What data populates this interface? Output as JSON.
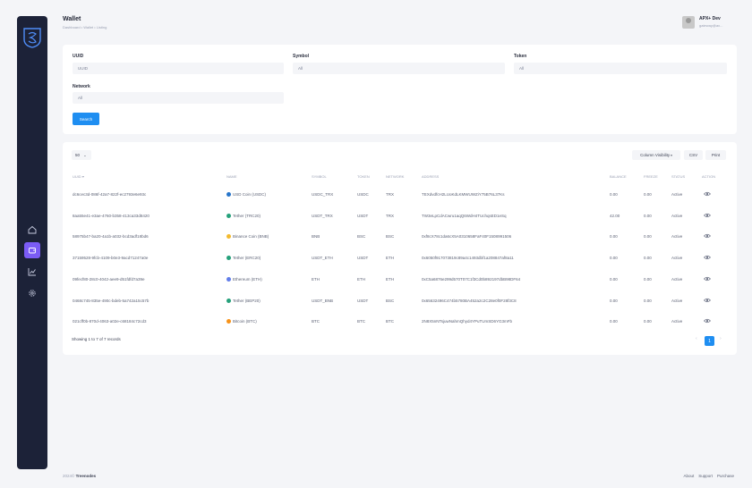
{
  "header": {
    "title": "Wallet",
    "breadcrumb": "Dashboard • Wallet • Listing"
  },
  "user": {
    "name": "APX+ Dev",
    "email": "gateway@ax..."
  },
  "sidebar": {
    "items": [
      "home-icon",
      "wallet-icon",
      "chart-icon",
      "settings-icon"
    ],
    "active_index": 1
  },
  "filters": {
    "uuid_label": "UUID",
    "uuid_placeholder": "UUID",
    "symbol_label": "Symbol",
    "symbol_value": "All",
    "token_label": "Token",
    "token_value": "All",
    "network_label": "Network",
    "network_value": "All",
    "search_label": "Search"
  },
  "table_tools": {
    "page_size": "50",
    "column_visibility": "Column Visibility",
    "csv": "CSV",
    "print": "Print"
  },
  "columns": [
    "UUID",
    "NAME",
    "SYMBOL",
    "TOKEN",
    "NETWORK",
    "ADDRESS",
    "BALANCE",
    "FREEZE",
    "STATUS",
    "ACTION"
  ],
  "rows": [
    {
      "uuid": "dc6cec3d-086f-42a7-822f-ec2793e6e93c",
      "name": "USD Coin (USDC)",
      "coin_color": "#2775ca",
      "symbol": "USDC_TRX",
      "token": "USDC",
      "network": "TRX",
      "address": "TEXdvdfcH2LUoKdLKMWUWZiY75B76L37Ks",
      "balance": "0.00",
      "freeze": "0.00",
      "status": "Active"
    },
    {
      "uuid": "8aa55e41-e3ae-4760-b358-413ca33d8420",
      "name": "Tether (TRC20)",
      "coin_color": "#26a17b",
      "symbol": "USDT_TRX",
      "token": "USDT",
      "network": "TRX",
      "address": "TW3eLpCdACwru1aqQ6WdH4TUchqsED1eSq",
      "balance": "42.00",
      "freeze": "0.00",
      "status": "Active"
    },
    {
      "uuid": "58975b47-ba20-4a1b-a032-bcd3adf18bd6",
      "name": "Binance Coin (BNB)",
      "coin_color": "#f3ba2f",
      "symbol": "BNB",
      "token": "BSC",
      "network": "BSC",
      "address": "0xf8cX78c1da6cX5A0310658FaF40F1508991506",
      "balance": "0.00",
      "freeze": "0.00",
      "status": "Active"
    },
    {
      "uuid": "37159528-9fcb-4109-b0e3-9acd71247a0e",
      "name": "Tether (ERC20)",
      "coin_color": "#26a17b",
      "symbol": "USDT_ETH",
      "token": "USDT",
      "network": "ETH",
      "address": "0x6050f917073819c89a4c1493dbf1a208847af8a11",
      "balance": "0.00",
      "freeze": "0.00",
      "status": "Active"
    },
    {
      "uuid": "09fecf80-28c0-4042-aee9-d51fdfd7a39e",
      "name": "Ethereum (ETH)",
      "coin_color": "#627eea",
      "symbol": "ETH",
      "token": "ETH",
      "network": "ETH",
      "address": "0xC5a6876e299d570T07C1f3Cd0b892197dbB98DF64",
      "balance": "0.00",
      "freeze": "0.00",
      "status": "Active"
    },
    {
      "uuid": "0468c745-835e-490c-bdeb-5a742a15c57b",
      "name": "Tether (BEP20)",
      "coin_color": "#26a17b",
      "symbol": "USDT_BNB",
      "token": "USDT",
      "network": "BSC",
      "address": "0x65632496C474b5780BA452a2c2C28e0f0F28f3C8",
      "balance": "0.00",
      "freeze": "0.00",
      "status": "Active"
    },
    {
      "uuid": "021cff0b-870d-4063-a02e-c68184c72cd3",
      "name": "Bitcoin (BTC)",
      "coin_color": "#f7931a",
      "symbol": "BTC",
      "token": "BTC",
      "network": "BTC",
      "address": "2N8X5nNTsjuwNahmQhyd4YPuTUmSD6YG3mFb",
      "balance": "0.00",
      "freeze": "0.00",
      "status": "Active"
    }
  ],
  "showing_text": "Showing 1 to 7 of 7 records",
  "pagination": {
    "prev": "‹",
    "current": "1",
    "next": "›"
  },
  "footer": {
    "year": "2024©",
    "brand": "Treenodes",
    "links": [
      "About",
      "Support",
      "Purchase"
    ]
  },
  "colors": {
    "primary": "#1f8ef1",
    "sidebar": "#1c2238",
    "active_nav": "#7b5cf5"
  }
}
